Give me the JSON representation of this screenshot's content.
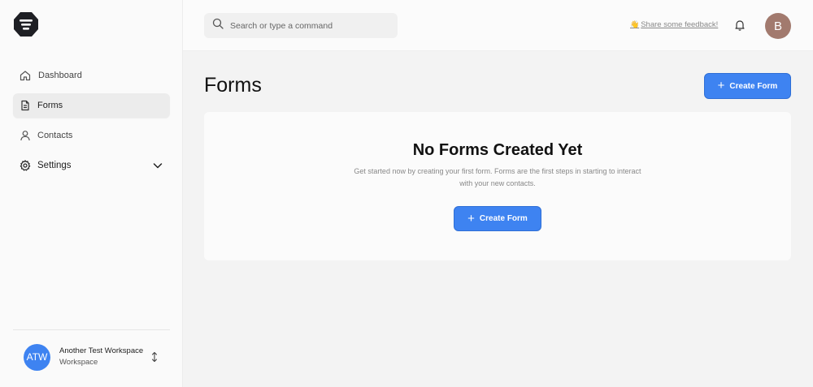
{
  "sidebar": {
    "items": [
      {
        "label": "Dashboard",
        "icon": "home-icon"
      },
      {
        "label": "Forms",
        "icon": "document-icon",
        "active": true
      },
      {
        "label": "Contacts",
        "icon": "user-icon"
      },
      {
        "label": "Settings",
        "icon": "gear-icon",
        "expandable": true
      }
    ],
    "workspace": {
      "initials": "ATW",
      "name": "Another Test Workspace",
      "type": "Workspace"
    }
  },
  "header": {
    "search_placeholder": "Search or type a command",
    "feedback_emoji": "👋",
    "feedback_label": "Share some feedback!",
    "avatar_initial": "B"
  },
  "main": {
    "title": "Forms",
    "create_button_label": "Create Form",
    "empty_state": {
      "title": "No Forms Created Yet",
      "description": "Get started now by creating your first form. Forms are the first steps in starting to interact with your new contacts.",
      "button_label": "Create Form"
    }
  },
  "colors": {
    "accent": "#3e83f1",
    "avatar": "#a27a6e"
  }
}
